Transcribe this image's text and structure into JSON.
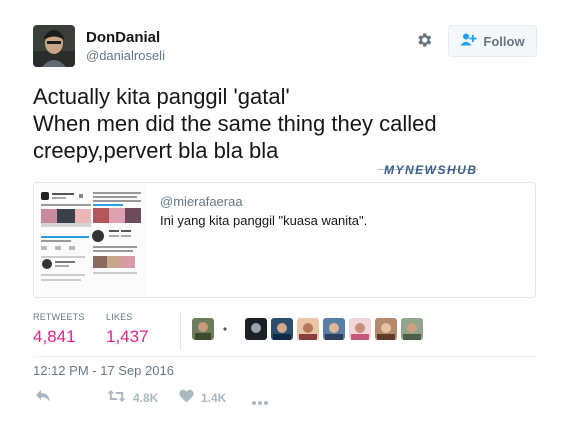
{
  "author": {
    "name": "DonDanial",
    "handle": "@danialroseli"
  },
  "follow_button": {
    "label": "Follow"
  },
  "tweet": {
    "lines": [
      "Actually kita panggil 'gatal'",
      "When men did the same thing they called",
      "creepy,pervert bla bla bla"
    ]
  },
  "watermark": "MYNEWSHUB",
  "quoted": {
    "handle": "@mierafaeraa",
    "text": "Ini yang kita panggil \"kuasa wanita\"."
  },
  "stats": {
    "retweets_label": "RETWEETS",
    "retweets_value": "4,841",
    "likes_label": "LIKES",
    "likes_value": "1,437"
  },
  "timestamp": "12:12 PM - 17 Sep 2016",
  "actions": {
    "retweet_count": "4.8K",
    "like_count": "1.4K"
  },
  "colors": {
    "text": "#14171a",
    "secondary": "#657786",
    "stat_value": "#e0248c",
    "action_icon": "#aab8c2",
    "border": "#e1e8ed"
  },
  "icons": [
    "gear-icon",
    "add-user-icon",
    "reply-icon",
    "retweet-icon",
    "heart-icon",
    "more-icon"
  ]
}
